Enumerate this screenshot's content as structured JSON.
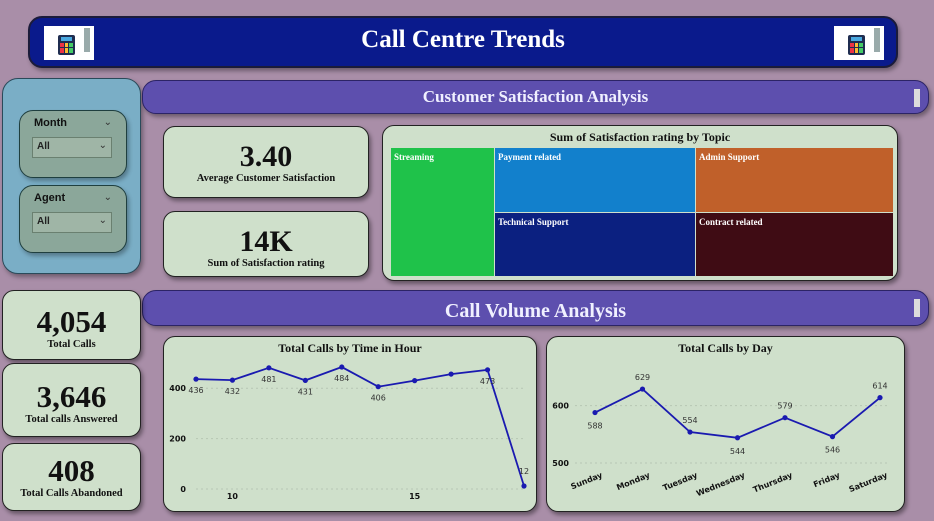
{
  "header": {
    "title": "Call Centre Trends"
  },
  "sections": {
    "satisfaction": "Customer Satisfaction Analysis",
    "volume": "Call Volume Analysis"
  },
  "filters": {
    "month": {
      "label": "Month",
      "value": "All"
    },
    "agent": {
      "label": "Agent",
      "value": "All"
    }
  },
  "kpis": {
    "avg_satisfaction": {
      "value": "3.40",
      "label": "Average Customer Satisfaction"
    },
    "sum_satisfaction": {
      "value": "14K",
      "label": "Sum of Satisfaction rating"
    },
    "total_calls": {
      "value": "4,054",
      "label": "Total Calls"
    },
    "answered": {
      "value": "3,646",
      "label": "Total calls Answered"
    },
    "abandoned": {
      "value": "408",
      "label": "Total Calls Abandoned"
    }
  },
  "colors": {
    "header": "#0a1a8c",
    "section": "#5d4fae",
    "card": "#cfe0cb",
    "line": "#1a1ab0"
  },
  "chart_data": [
    {
      "type": "treemap",
      "title": "Sum of Satisfaction rating by Topic",
      "tiles": [
        {
          "label": "Streaming",
          "color": "#1fc24a"
        },
        {
          "label": "Payment related",
          "color": "#1280cc"
        },
        {
          "label": "Admin Support",
          "color": "#c0602a"
        },
        {
          "label": "Technical Support",
          "color": "#0b2080"
        },
        {
          "label": "Contract related",
          "color": "#3f0c14"
        }
      ]
    },
    {
      "type": "line",
      "title": "Total Calls by Time in Hour",
      "x": [
        9,
        10,
        11,
        12,
        13,
        14,
        15,
        16,
        17,
        18
      ],
      "y": [
        436,
        432,
        481,
        431,
        484,
        406,
        430,
        456,
        473,
        12
      ],
      "point_labels": [
        "436",
        "432",
        "481",
        "431",
        "484",
        "406",
        "",
        "",
        "473",
        "12"
      ],
      "ylim": [
        0,
        500
      ],
      "yticks": [
        0,
        200,
        400
      ],
      "xticks": [
        10,
        15
      ]
    },
    {
      "type": "line",
      "title": "Total Calls by Day",
      "categories": [
        "Sunday",
        "Monday",
        "Tuesday",
        "Wednesday",
        "Thursday",
        "Friday",
        "Saturday"
      ],
      "y": [
        588,
        629,
        554,
        544,
        579,
        546,
        614
      ],
      "ylim": [
        500,
        650
      ],
      "yticks": [
        500,
        600
      ]
    }
  ]
}
